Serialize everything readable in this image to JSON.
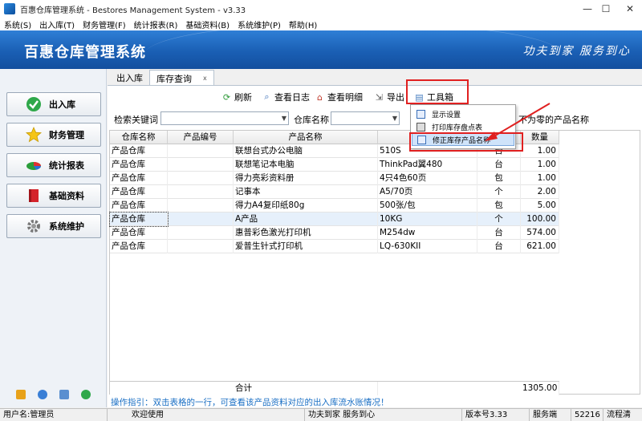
{
  "window": {
    "title": "百惠仓库管理系统 - Bestores Management System - v3.33",
    "minimize": "—",
    "maximize": "☐",
    "close": "✕"
  },
  "menu": [
    "系统(S)",
    "出入库(T)",
    "财务管理(F)",
    "统计报表(R)",
    "基础资料(B)",
    "系统维护(P)",
    "帮助(H)"
  ],
  "banner": {
    "title": "百惠仓库管理系统",
    "slogan": "功夫到家 服务到心"
  },
  "sidebar": {
    "items": [
      {
        "label": "出入库",
        "icon": "check-icon"
      },
      {
        "label": "财务管理",
        "icon": "star-icon"
      },
      {
        "label": "统计报表",
        "icon": "pie-chart-icon"
      },
      {
        "label": "基础资料",
        "icon": "book-icon"
      },
      {
        "label": "系统维护",
        "icon": "gear-icon"
      }
    ]
  },
  "tabs": [
    {
      "label": "出入库",
      "active": false
    },
    {
      "label": "库存查询",
      "active": true,
      "close": "x"
    }
  ],
  "toolbar": {
    "refresh": "刷新",
    "view_log": "查看日志",
    "view_detail": "查看明细",
    "export": "导出",
    "toolbox": "工具箱"
  },
  "search": {
    "keyword_label": "检索关键词",
    "keyword_value": "",
    "warehouse_label": "仓库名称",
    "warehouse_value": "",
    "nonzero_label": "不为零的产品名称"
  },
  "dropdown": {
    "items": [
      "显示设置",
      "打印库存盘点表",
      "修正库存产品名称"
    ]
  },
  "table": {
    "headers": [
      "仓库名称",
      "产品编号",
      "产品名称",
      "型号",
      "单位",
      "数量"
    ],
    "rows": [
      [
        "产品仓库",
        "",
        "联想台式办公电脑",
        "510S",
        "台",
        "1.00"
      ],
      [
        "产品仓库",
        "",
        "联想笔记本电脑",
        "ThinkPad翼480",
        "台",
        "1.00"
      ],
      [
        "产品仓库",
        "",
        "得力亮彩资料册",
        "4只4色60页",
        "包",
        "1.00"
      ],
      [
        "产品仓库",
        "",
        "记事本",
        "A5/70页",
        "个",
        "2.00"
      ],
      [
        "产品仓库",
        "",
        "得力A4复印纸80g",
        "500张/包",
        "包",
        "5.00"
      ],
      [
        "产品仓库",
        "",
        "A产品",
        "10KG",
        "个",
        "100.00"
      ],
      [
        "产品仓库",
        "",
        "惠普彩色激光打印机",
        "M254dw",
        "台",
        "574.00"
      ],
      [
        "产品仓库",
        "",
        "爱普生针式打印机",
        "LQ-630KII",
        "台",
        "621.00"
      ]
    ],
    "selected_row": 5,
    "total_label": "合计",
    "total_value": "1305.00"
  },
  "hint": "操作指引：双击表格的一行，可查看该产品资料对应的出入库流水账情况！",
  "status": {
    "user": "用户名:管理员",
    "welcome": "欢迎使用",
    "slogan": "功夫到家 服务到心",
    "version": "版本号3.33",
    "server": "服务端",
    "port": "52216",
    "flow": "流程清"
  },
  "colors": {
    "banner": "#1a5fb4",
    "highlight": "#e02020",
    "hint": "#1a6fc4"
  }
}
